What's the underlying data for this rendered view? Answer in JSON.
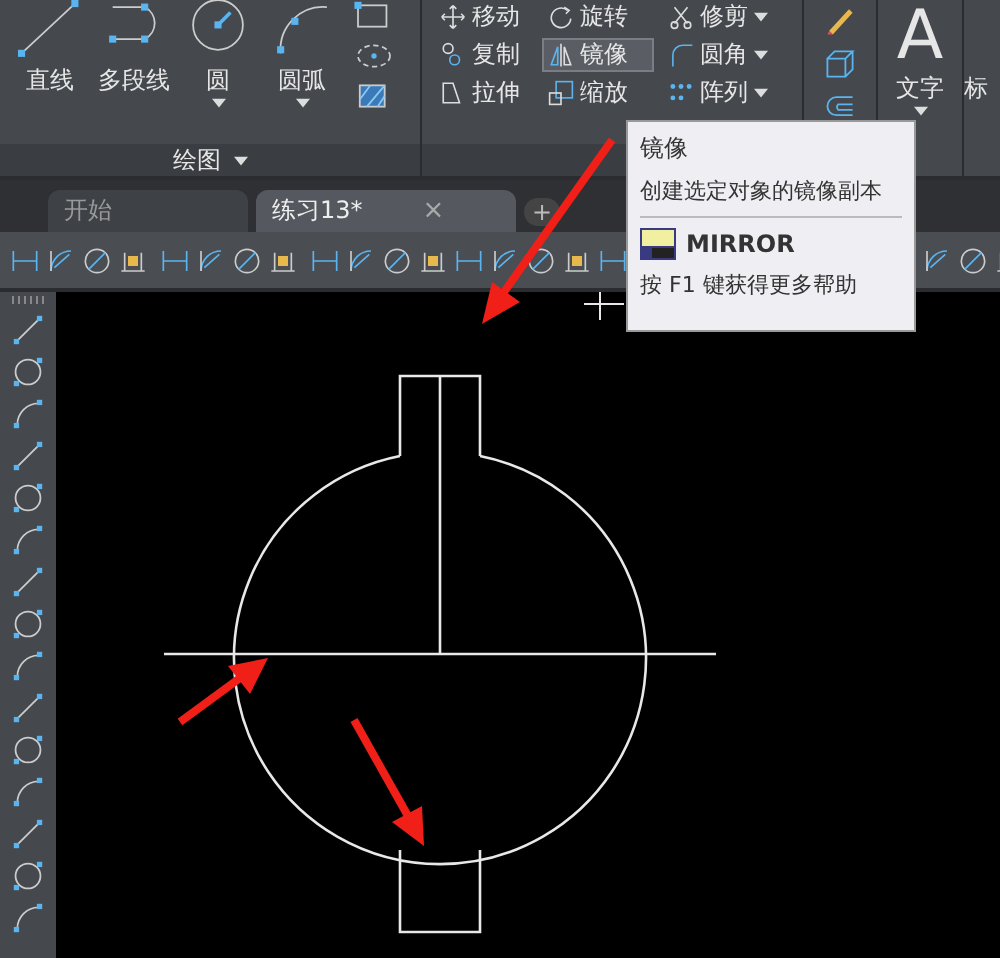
{
  "ribbon": {
    "draw_panel": {
      "title": "绘图",
      "tools": [
        {
          "label": "直线",
          "kind": "line",
          "has_menu": false
        },
        {
          "label": "多段线",
          "kind": "polyline",
          "has_menu": false
        },
        {
          "label": "圆",
          "kind": "circle",
          "has_menu": true
        },
        {
          "label": "圆弧",
          "kind": "arc",
          "has_menu": true
        }
      ]
    },
    "modify_panel": {
      "tools": [
        {
          "label": "移动",
          "kind": "move",
          "selected": false,
          "has_menu": false
        },
        {
          "label": "旋转",
          "kind": "rotate",
          "selected": false,
          "has_menu": false
        },
        {
          "label": "修剪",
          "kind": "trim",
          "selected": false,
          "has_menu": true
        },
        {
          "label": "复制",
          "kind": "copy",
          "selected": false,
          "has_menu": false
        },
        {
          "label": "镜像",
          "kind": "mirror",
          "selected": true,
          "has_menu": false
        },
        {
          "label": "圆角",
          "kind": "fillet",
          "selected": false,
          "has_menu": true
        },
        {
          "label": "拉伸",
          "kind": "stretch",
          "selected": false,
          "has_menu": false
        },
        {
          "label": "缩放",
          "kind": "scale",
          "selected": false,
          "has_menu": false
        },
        {
          "label": "阵列",
          "kind": "array",
          "selected": false,
          "has_menu": true
        }
      ]
    },
    "annotation_panel": {
      "tools": [
        {
          "label": "文字",
          "glyph": "A"
        }
      ],
      "cut_label": "标"
    }
  },
  "file_tabs": [
    {
      "label": "开始",
      "selected": false,
      "closable": false
    },
    {
      "label": "练习13*",
      "selected": true,
      "closable": true
    }
  ],
  "new_tab_button": "+",
  "close_glyph": "×",
  "tooltip": {
    "title": "镜像",
    "description": "创建选定对象的镜像副本",
    "command": "MIRROR",
    "help": "按 F1 键获得更多帮助"
  }
}
